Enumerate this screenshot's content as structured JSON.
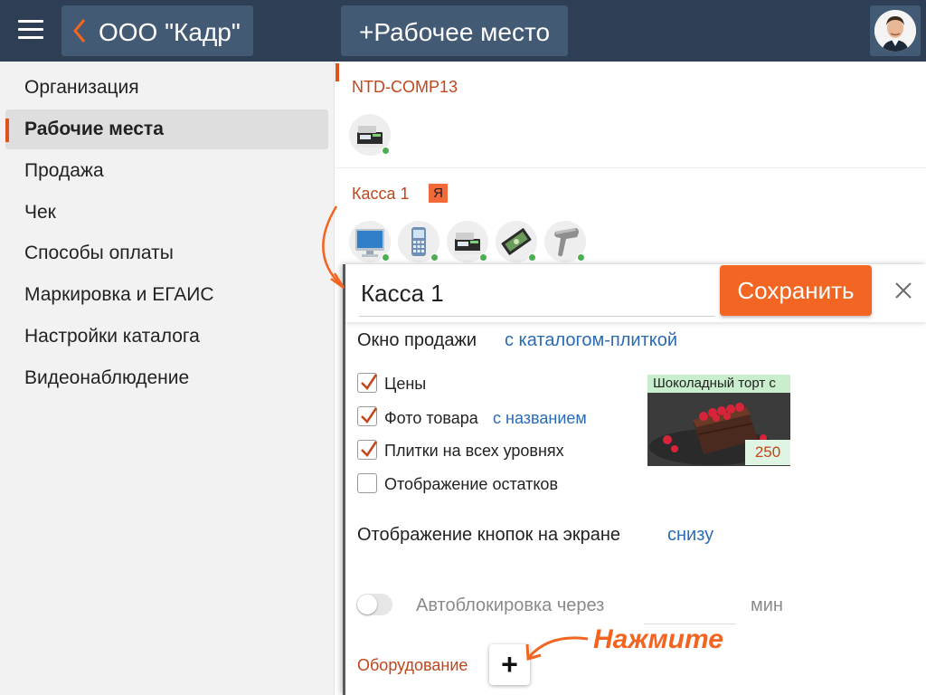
{
  "header": {
    "org_name": "ООО \"Кадр\"",
    "add_workplace_label": "+Рабочее место"
  },
  "sidebar": {
    "items": [
      {
        "label": "Организация"
      },
      {
        "label": "Рабочие места",
        "active": true
      },
      {
        "label": "Продажа"
      },
      {
        "label": "Чек"
      },
      {
        "label": "Способы оплаты"
      },
      {
        "label": "Маркировка и ЕГАИС"
      },
      {
        "label": "Настройки каталога"
      },
      {
        "label": "Видеонаблюдение"
      }
    ]
  },
  "workplaces": [
    {
      "name": "NTD-COMP13",
      "devices": [
        "cash-register-icon"
      ]
    },
    {
      "name": "Касса 1",
      "badge": "Я",
      "devices": [
        "monitor-icon",
        "card-terminal-icon",
        "cash-register-icon",
        "cash-drawer-icon",
        "barcode-scanner-icon"
      ]
    }
  ],
  "panel": {
    "name_value": "Касса 1",
    "save_label": "Сохранить",
    "sale_window_label": "Окно продажи",
    "sale_window_value": "с каталогом-плиткой",
    "options": [
      {
        "label": "Цены",
        "checked": true
      },
      {
        "label": "Фото товара",
        "checked": true,
        "link": "с названием"
      },
      {
        "label": "Плитки на всех уровнях",
        "checked": true
      },
      {
        "label": "Отображение остатков",
        "checked": false
      }
    ],
    "tile": {
      "title": "Шоколадный торт с",
      "price": "250"
    },
    "buttons_display_label": "Отображение кнопок на экране",
    "buttons_display_value": "снизу",
    "autolock_label": "Автоблокировка через",
    "autolock_unit": "мин",
    "autolock_enabled": false,
    "equipment_label": "Оборудование",
    "add_equipment_label": "+"
  },
  "annotation": {
    "hint": "Нажмите"
  },
  "colors": {
    "topbar": "#2e3f55",
    "accent": "#f26522",
    "link": "#2a6bb3",
    "status_ok": "#4caf50"
  }
}
